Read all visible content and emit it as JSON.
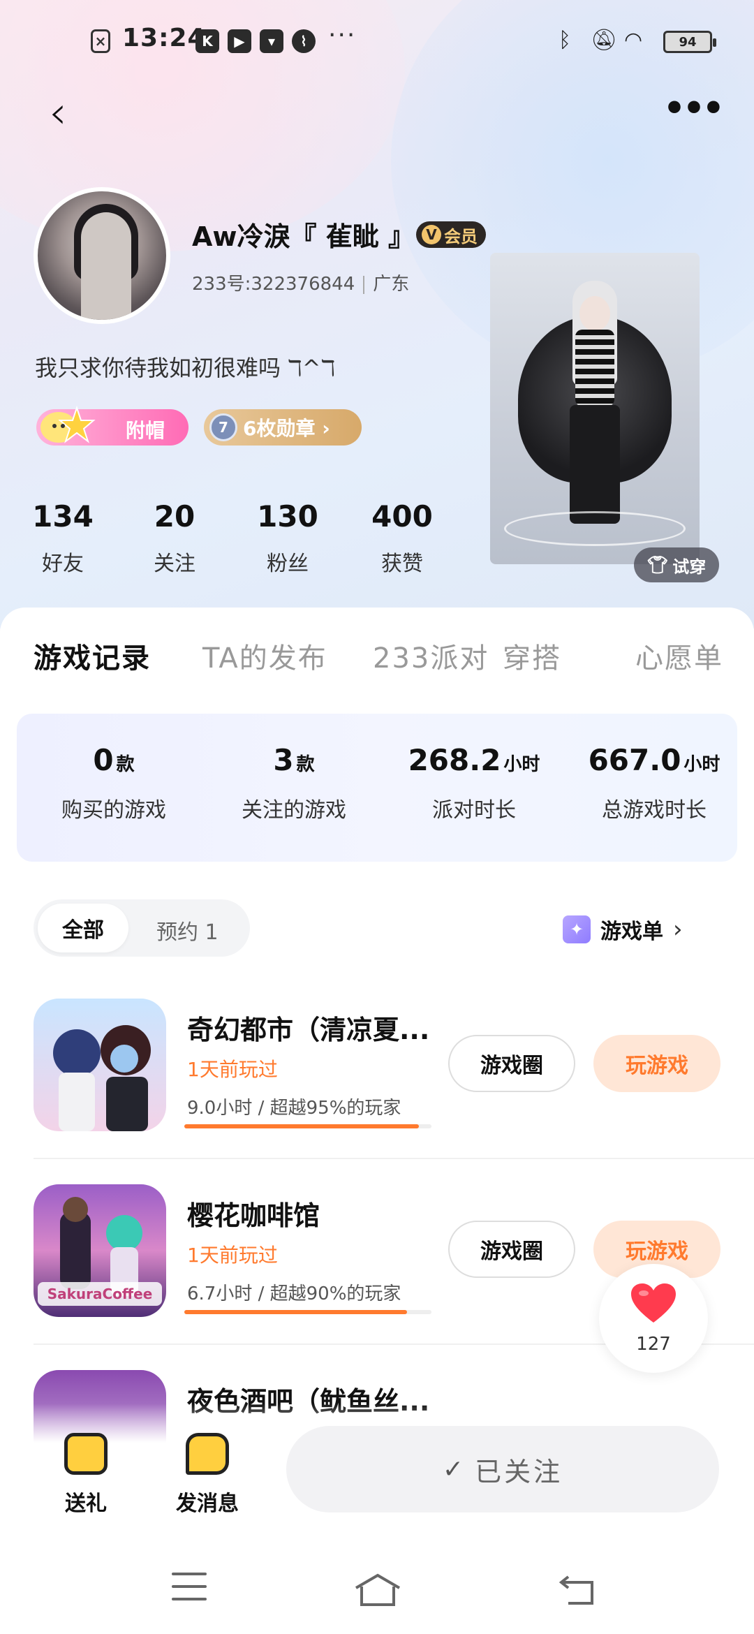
{
  "status_bar": {
    "time": "13:24",
    "app_icons": [
      "K",
      "▶",
      "▾",
      "⌇"
    ],
    "more": "···",
    "right_icons": [
      "bluetooth-icon",
      "mute-icon",
      "wifi-icon"
    ],
    "battery": "94"
  },
  "nav": {
    "back": "‹",
    "more": "•••"
  },
  "profile": {
    "nickname": "Aw冷淚『 雈眦 』",
    "vip": "会员",
    "id_text": "233号:322376844",
    "region": "广东",
    "bio": "我只求你待我如初很难吗 ℸ^ℸ",
    "title_badge": "附帽",
    "medals": "6枚勋章 ›",
    "medal_number": "7",
    "try_on": "试穿"
  },
  "stats": [
    {
      "value": "134",
      "label": "好友"
    },
    {
      "value": "20",
      "label": "关注"
    },
    {
      "value": "130",
      "label": "粉丝"
    },
    {
      "value": "400",
      "label": "获赞"
    }
  ],
  "tabs": [
    "游戏记录",
    "TA的发布",
    "233派对",
    "穿搭",
    "心愿单"
  ],
  "summary": [
    {
      "value": "0",
      "unit": "款",
      "label": "购买的游戏"
    },
    {
      "value": "3",
      "unit": "款",
      "label": "关注的游戏"
    },
    {
      "value": "268.2",
      "unit": "小时",
      "label": "派对时长"
    },
    {
      "value": "667.0",
      "unit": "小时",
      "label": "总游戏时长"
    }
  ],
  "filter": {
    "all": "全部",
    "reserve": "预约 1",
    "game_list": "游戏单",
    "chevron": "›"
  },
  "games": [
    {
      "name": "奇幻都市（清凉夏...",
      "played": "1天前玩过",
      "hours": "9.0小时 / 超越95%的玩家",
      "progress": 0.95,
      "circle": "游戏圈",
      "play": "玩游戏"
    },
    {
      "name": "樱花咖啡馆",
      "played": "1天前玩过",
      "hours": "6.7小时 / 超越90%的玩家",
      "progress": 0.9,
      "circle": "游戏圈",
      "play": "玩游戏"
    },
    {
      "name": "夜色酒吧（鱿鱼丝...",
      "played": "",
      "hours": "",
      "progress": 0,
      "circle": "",
      "play": ""
    }
  ],
  "like": {
    "count": "127"
  },
  "actions": {
    "gift": "送礼",
    "message": "发消息",
    "followed": "已关注",
    "check": "✓"
  },
  "colors": {
    "accent": "#ff7a2e",
    "pink": "#ff6bb5",
    "gold": "#d7a96a"
  }
}
